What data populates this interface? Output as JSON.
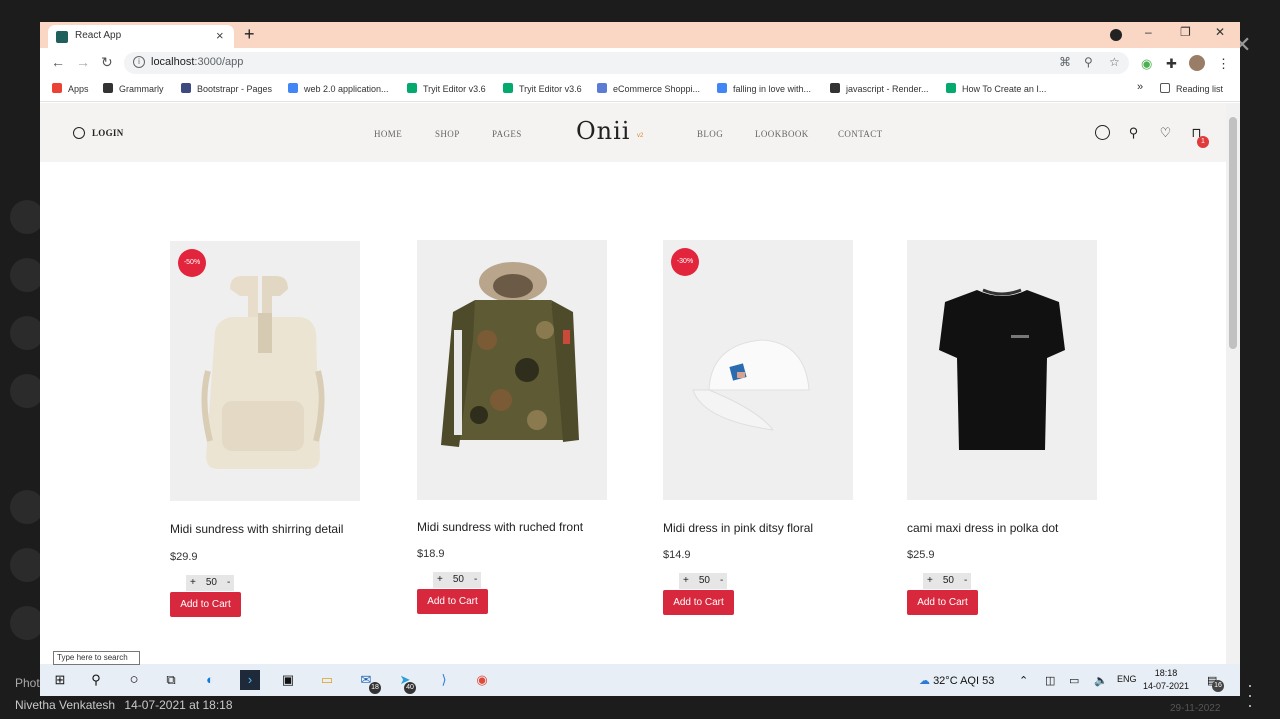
{
  "browser": {
    "tab_title": "React App",
    "tab_close": "×",
    "new_tab": "+",
    "url_host": "localhost",
    "url_path": ":3000/app",
    "window_controls": [
      "–",
      "❐",
      "✕"
    ],
    "bookmarks": [
      {
        "label": "Apps",
        "icon": "apps-grid-icon",
        "color": "#ea4335"
      },
      {
        "label": "Grammarly",
        "icon": "globe-icon",
        "color": "#333333"
      },
      {
        "label": "Bootstrapr - Pages",
        "icon": "bootstrapr-icon",
        "color": "#3c4a80"
      },
      {
        "label": "web 2.0 application...",
        "icon": "google-icon",
        "color": "#4285f4"
      },
      {
        "label": "Tryit Editor v3.6",
        "icon": "w3schools-icon",
        "color": "#04aa6d"
      },
      {
        "label": "Tryit Editor v3.6",
        "icon": "w3schools-icon",
        "color": "#04aa6d"
      },
      {
        "label": "eCommerce Shoppi...",
        "icon": "msb-icon",
        "color": "#5b7bd5"
      },
      {
        "label": "falling in love with...",
        "icon": "google-icon",
        "color": "#4285f4"
      },
      {
        "label": "javascript - Render...",
        "icon": "globe-icon",
        "color": "#333333"
      },
      {
        "label": "How To Create an I...",
        "icon": "w3schools-icon",
        "color": "#04aa6d"
      }
    ],
    "bookmarks_more": "»",
    "reading_list": "Reading list"
  },
  "site": {
    "login": "LOGIN",
    "nav_left": [
      "HOME",
      "SHOP",
      "PAGES"
    ],
    "logo": "Onii",
    "logo_sup": "v2",
    "nav_right": [
      "BLOG",
      "LOOKBOOK",
      "CONTACT"
    ],
    "cart_count": "1"
  },
  "products": [
    {
      "name": "Midi sundress with shirring detail",
      "price": "$29.9",
      "discount": "-50%",
      "qty": "50",
      "button": "Add to Cart",
      "image": "backpack"
    },
    {
      "name": "Midi sundress with ruched front",
      "price": "$18.9",
      "discount": "",
      "qty": "50",
      "button": "Add to Cart",
      "image": "camo-parka"
    },
    {
      "name": "Midi dress in pink ditsy floral",
      "price": "$14.9",
      "discount": "-30%",
      "qty": "50",
      "button": "Add to Cart",
      "image": "white-cap"
    },
    {
      "name": "cami maxi dress in polka dot",
      "price": "$25.9",
      "discount": "",
      "qty": "50",
      "button": "Add to Cart",
      "image": "black-tshirt"
    }
  ],
  "qty_controls": {
    "plus": "+",
    "minus": "-"
  },
  "taskbar": {
    "search_tooltip": "Type here to search",
    "weather": "32°C  AQI 53",
    "lang": "ENG",
    "time": "18:18",
    "date": "14-07-2021",
    "notifications": "16",
    "mail_badge": "18",
    "telegram_badge": "40"
  },
  "viewer": {
    "label": "Phot",
    "author": "Nivetha Venkatesh",
    "timestamp": "14-07-2021 at 18:18",
    "faded_date": "29-11-2022",
    "close": "✕"
  }
}
